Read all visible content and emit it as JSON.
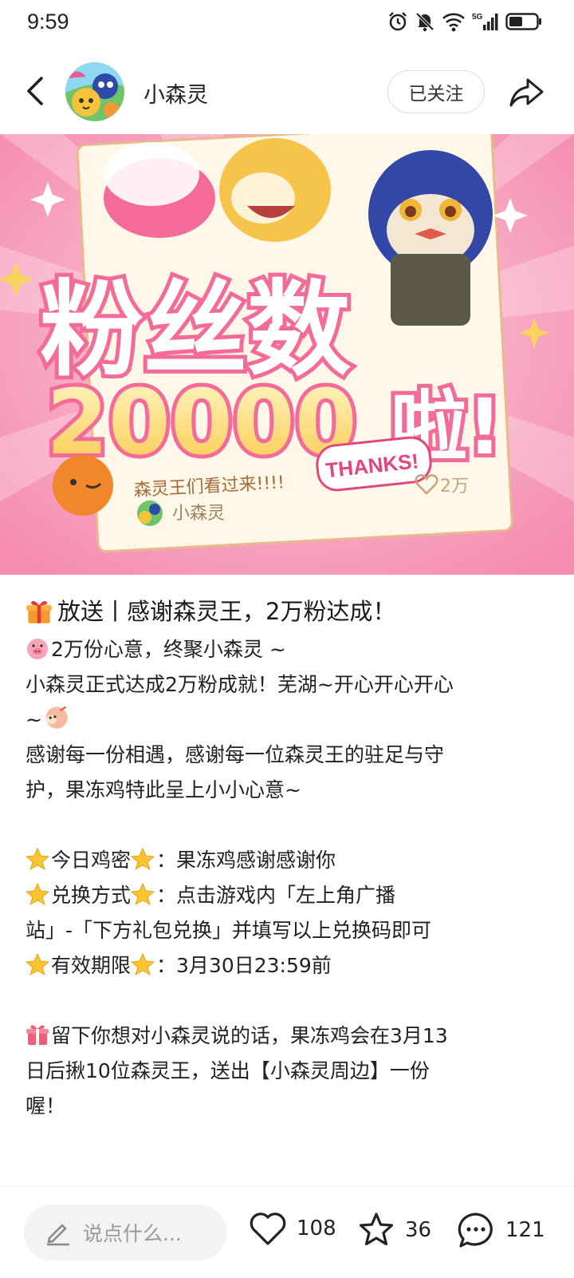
{
  "status_bar": {
    "time": "9:59",
    "network": "5G"
  },
  "header": {
    "username": "小森灵",
    "follow_label": "已关注"
  },
  "banner": {
    "headline_line1": "粉丝数",
    "headline_line2_number": "20000",
    "headline_line2_suffix": "啦!",
    "caption": "森灵王们看过来!!!!",
    "thanks": "THANKS!",
    "likes": "2万",
    "account": "小森灵"
  },
  "post": {
    "title": "放送丨感谢森灵王，2万粉达成！",
    "lines": [
      "2万份心意，终聚小森灵 ~",
      "小森灵正式达成2万粉成就！芜湖~开心开心开心",
      "~",
      "感谢每一份相遇，感谢每一位森灵王的驻足与守",
      "护，果冻鸡特此呈上小小心意~",
      "",
      "今日鸡密",
      "：果冻鸡感谢感谢你",
      "兑换方式",
      "：点击游戏内「左上角广播",
      "站」-「下方礼包兑换」并填写以上兑换码即可",
      "有效期限",
      "：3月30日23:59前",
      "",
      "留下你想对小森灵说的话，果冻鸡会在3月13",
      "日后揪10位森灵王，送出【小森灵周边】一份",
      "喔！"
    ]
  },
  "bottom_bar": {
    "comment_placeholder": "说点什么...",
    "likes": "108",
    "favorites": "36",
    "comments": "121"
  },
  "colors": {
    "accent_pink": "#f46b9a",
    "banner_bg": "#f7a3bf",
    "star": "#f7c531"
  }
}
